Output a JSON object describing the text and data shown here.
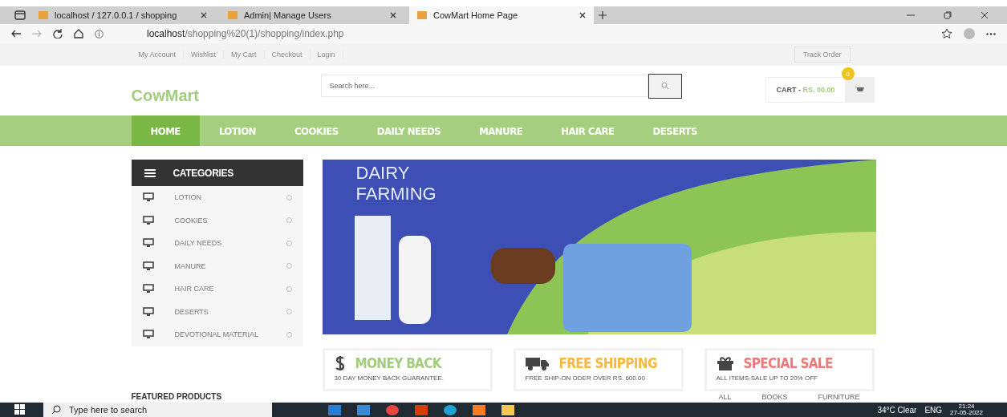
{
  "browser": {
    "tabs": [
      {
        "title": "localhost / 127.0.0.1 / shopping",
        "selected": false
      },
      {
        "title": "Admin| Manage Users",
        "selected": false
      },
      {
        "title": "CowMart Home Page",
        "selected": true
      }
    ],
    "address": {
      "host": "localhost",
      "path": "/shopping%20(1)/shopping/index.php"
    }
  },
  "topbar": {
    "links": [
      "My Account",
      "Wishlist",
      "My Cart",
      "Checkout",
      "Login"
    ],
    "track_order": "Track Order"
  },
  "header": {
    "logo": "CowMart",
    "search": {
      "placeholder": "Search here..."
    },
    "cart": {
      "label": "CART -",
      "amount": "RS. 00.00",
      "count": "0"
    }
  },
  "nav": [
    {
      "label": "HOME",
      "selected": true
    },
    {
      "label": "LOTION",
      "selected": false
    },
    {
      "label": "COOKIES",
      "selected": false
    },
    {
      "label": "DAILY NEEDS",
      "selected": false
    },
    {
      "label": "MANURE",
      "selected": false
    },
    {
      "label": "HAIR CARE",
      "selected": false
    },
    {
      "label": "DESERTS",
      "selected": false
    }
  ],
  "categories": {
    "title": "CATEGORIES",
    "items": [
      "LOTION",
      "COOKIES",
      "DAILY NEEDS",
      "MANURE",
      "HAIR CARE",
      "DESERTS",
      "DEVOTIONAL MATERIAL"
    ]
  },
  "banner": {
    "title_lines": [
      "DAIRY",
      "FARMING"
    ]
  },
  "features": [
    {
      "kind": "money",
      "title": "MONEY BACK",
      "subtitle": "30 DAY MONEY BACK GUARANTEE.",
      "color": "#a3cd7e"
    },
    {
      "kind": "shipping",
      "title": "FREE SHIPPING",
      "subtitle": "FREE SHIP-ON ODER OVER RS. 600.00",
      "color": "#f5b941"
    },
    {
      "kind": "sale",
      "title": "SPECIAL SALE",
      "subtitle": "ALL ITEMS-SALE UP TO 20% OFF",
      "color": "#ec7a7a"
    }
  ],
  "featured": {
    "title": "FEATURED PRODUCTS",
    "filters": [
      "ALL",
      "BOOKS",
      "FURNITURE"
    ]
  },
  "taskbar": {
    "search_placeholder": "Type here to search",
    "weather": "34°C  Clear",
    "language": "ENG",
    "time": "21:24",
    "date": "27-05-2022"
  }
}
